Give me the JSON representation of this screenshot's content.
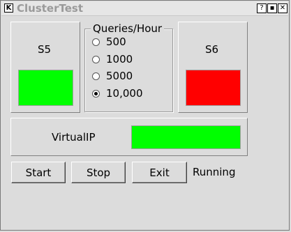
{
  "window": {
    "title": "ClusterTest",
    "app_icon": "k-icon",
    "controls": [
      "?",
      "▪",
      "✕"
    ]
  },
  "servers": [
    {
      "label": "S5",
      "status_color": "#00ff00"
    },
    {
      "label": "S6",
      "status_color": "#ff0000"
    }
  ],
  "queries": {
    "legend": "Queries/Hour",
    "options": [
      "500",
      "1000",
      "5000",
      "10,000"
    ],
    "selected": "10,000"
  },
  "virtual_ip": {
    "label": "VirtualIP",
    "status_color": "#00ff00"
  },
  "buttons": {
    "start": "Start",
    "stop": "Stop",
    "exit": "Exit"
  },
  "status_text": "Running"
}
